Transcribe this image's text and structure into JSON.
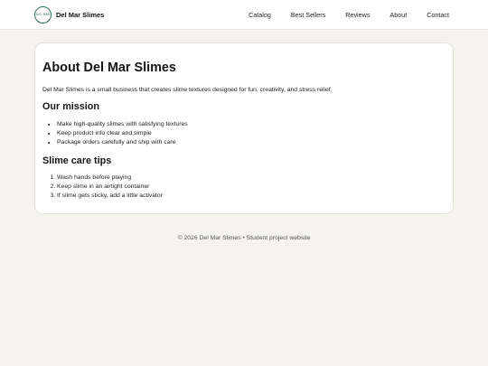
{
  "header": {
    "brand_name": "Del Mar Slimes",
    "logo_text": "DEL MAR",
    "nav": [
      "Catalog",
      "Best Sellers",
      "Reviews",
      "About",
      "Contact"
    ]
  },
  "main": {
    "title": "About Del Mar Slimes",
    "intro": "Del Mar Slimes is a small business that creates slime textures designed for fun, creativity, and stress relief.",
    "mission_title": "Our mission",
    "mission_items": [
      "Make high-quality slimes with satisfying textures",
      "Keep product info clear and simple",
      "Package orders carefully and ship with care"
    ],
    "care_title": "Slime care tips",
    "care_items": [
      "Wash hands before playing",
      "Keep slime in an airtight container",
      "If slime gets sticky, add a little activator"
    ]
  },
  "footer": {
    "text": "© 2026 Del Mar Slimes • Student project website"
  },
  "colors": {
    "background": "#f4f3ef",
    "card": "#ffffff",
    "logo_accent": "#2f6b4f"
  }
}
